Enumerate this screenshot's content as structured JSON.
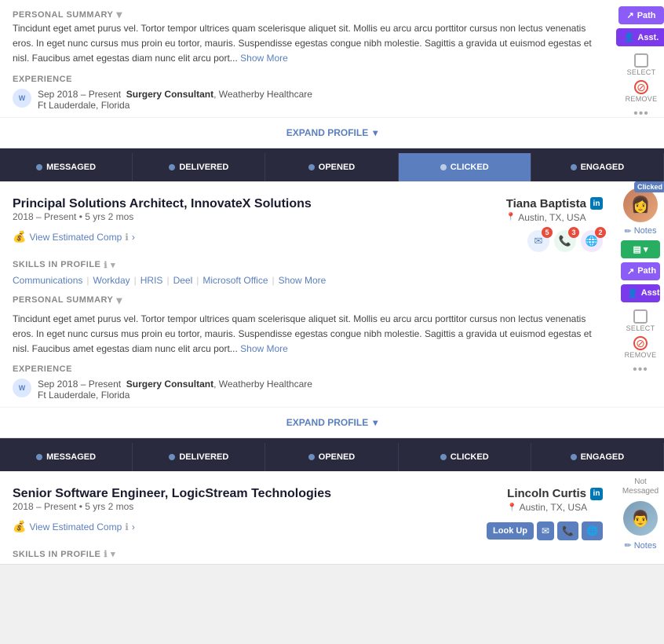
{
  "card1": {
    "summary_label": "PERSONAL SUMMARY",
    "summary_text": "Tincidunt eget amet purus vel. Tortor tempor ultrices quam scelerisque aliquet sit. Mollis eu arcu arcu porttitor cursus non lectus venenatis eros. In eget nunc cursus mus proin eu tortor, mauris. Suspendisse egestas congue nibh molestie. Sagittis a gravida ut euismod egestas et nisl. Faucibus amet egestas diam nunc elit arcu port...",
    "show_more": "Show More",
    "experience_label": "EXPERIENCE",
    "exp_date": "Sep 2018 – Present",
    "exp_title": "Surgery Consultant",
    "exp_company": ", Weatherby Healthcare",
    "exp_location": "Ft Lauderdale, Florida",
    "expand_profile": "EXPAND PROFILE",
    "path_btn": "Path",
    "asst_btn": "Asst.",
    "select_label": "SELECT",
    "remove_label": "REMOVE"
  },
  "status_bar": {
    "messaged": "MESSAGED",
    "delivered": "DELIVERED",
    "opened": "OPENED",
    "clicked": "CLICKED",
    "engaged": "ENGAGED"
  },
  "card2": {
    "title": "Principal Solutions Architect, InnovateX Solutions",
    "name": "Tiana Baptista",
    "dates": "2018 – Present  •  5 yrs 2 mos",
    "location": "Austin, TX, USA",
    "view_comp": "View Estimated Comp",
    "skills_label": "SKILLS IN PROFILE",
    "skills": [
      "Communications",
      "Workday",
      "HRIS",
      "Deel",
      "Microsoft Office"
    ],
    "show_more": "Show More",
    "summary_label": "PERSONAL SUMMARY",
    "summary_text": "Tincidunt eget amet purus vel. Tortor tempor ultrices quam scelerisque aliquet sit. Mollis eu arcu arcu porttitor cursus non lectus venenatis eros. In eget nunc cursus mus proin eu tortor, mauris. Suspendisse egestas congue nibh molestie. Sagittis a gravida ut euismod egestas et nisl. Faucibus amet egestas diam nunc elit arcu port...",
    "show_more2": "Show More",
    "experience_label": "EXPERIENCE",
    "exp_date": "Sep 2018 – Present",
    "exp_title": "Surgery Consultant",
    "exp_company": ", Weatherby Healthcare",
    "exp_location": "Ft Lauderdale, Florida",
    "expand_profile": "EXPAND PROFILE",
    "email_count": "5",
    "phone_count": "3",
    "web_count": "2",
    "notes_label": "Notes",
    "path_btn": "Path",
    "asst_btn": "Asst.",
    "select_label": "SELECT",
    "remove_label": "REMOVE",
    "clicked_status": "Clicked",
    "green_btn": "▾"
  },
  "card3": {
    "title": "Senior Software Engineer, LogicStream Technologies",
    "name": "Lincoln Curtis",
    "dates": "2018 – Present  •  5 yrs 2 mos",
    "location": "Austin, TX, USA",
    "view_comp": "View Estimated Comp",
    "skills_label": "SKILLS IN PROFILE",
    "not_messaged": "Not Messaged",
    "lookup_btn": "Look Up",
    "notes_label": "Notes"
  },
  "icons": {
    "arrow": "→",
    "chevron_down": "▾",
    "expand_arrow": "⌄",
    "location_pin": "📍",
    "pencil": "✏",
    "checkbox": "☐",
    "info": "ℹ",
    "path_icon": "↗",
    "asst_icon": "👤"
  }
}
